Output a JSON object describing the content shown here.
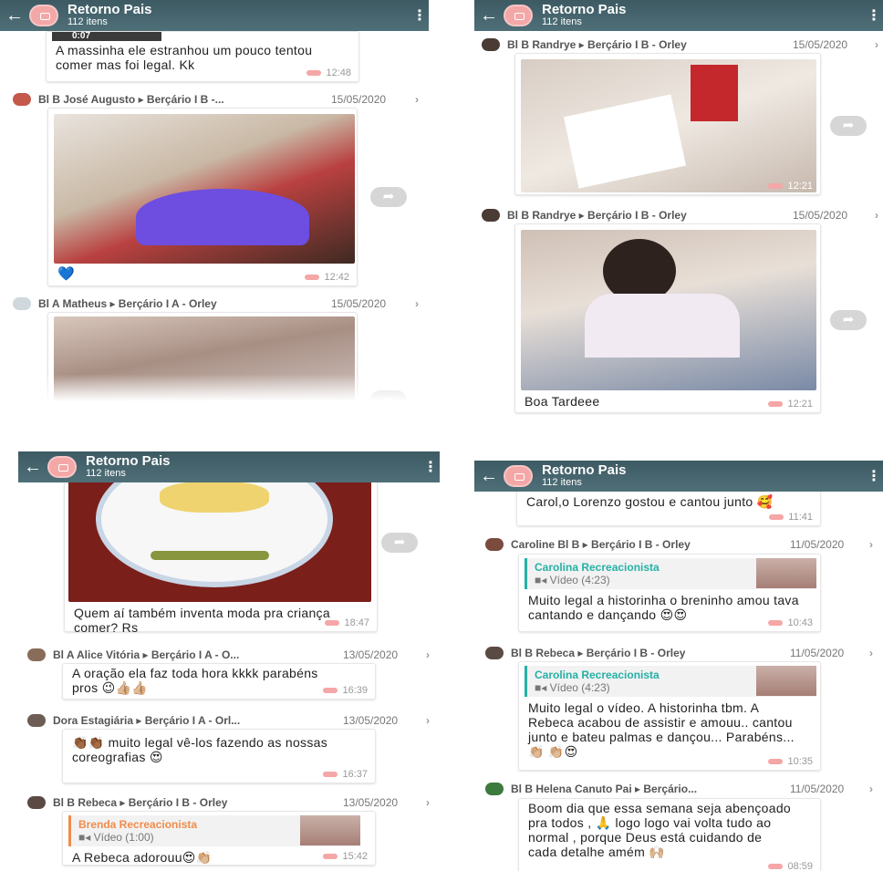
{
  "header": {
    "title": "Retorno Pais",
    "subtitle": "112 itens",
    "back_glyph": "←",
    "menu_glyph": "⋮"
  },
  "colors": {
    "appbar": "#4a6871",
    "avatar_pink": "#f4a7a7",
    "quote_teal": "#25b1a6",
    "quote_orange": "#f08c4a",
    "time_tag": "#f5a6a6"
  },
  "panel1": {
    "video_time": "0:07",
    "msg0": {
      "text": "A massinha ele estranhou um pouco tentou comer mas foi legal. Kk",
      "time": "12:48"
    },
    "msg1": {
      "sender": "Bl B José Augusto ▸ Berçário I B -...",
      "date": "15/05/2020",
      "emoji": "💙",
      "time": "12:42"
    },
    "msg2": {
      "sender": "Bl A Matheus ▸ Berçário I A - Orley",
      "date": "15/05/2020"
    }
  },
  "panel2": {
    "msg1": {
      "sender": "Bl B Randrye ▸ Berçário I B - Orley",
      "date": "15/05/2020",
      "time": "12:21"
    },
    "msg2": {
      "sender": "Bl B Randrye ▸ Berçário I B - Orley",
      "date": "15/05/2020",
      "text": "Boa Tardeee",
      "time": "12:21"
    }
  },
  "panel3": {
    "msg0": {
      "text": "Quem aí também inventa moda pra criança comer? Rs",
      "time": "18:47"
    },
    "msg1": {
      "sender": "Bl A Alice Vitória ▸ Berçário I A - O...",
      "date": "13/05/2020",
      "text": "A oração ela faz toda hora kkkk parabéns pros 😉👍🏼👍🏼",
      "time": "16:39"
    },
    "msg2": {
      "sender": "Dora Estagiária ▸ Berçário I A - Orl...",
      "date": "13/05/2020",
      "text": "👏🏾👏🏾 muito legal vê-los fazendo as nossas coreografias 😍",
      "time": "16:37"
    },
    "msg3": {
      "sender": "Bl B Rebeca ▸ Berçário I B - Orley",
      "date": "13/05/2020",
      "quote_name": "Brenda Recreacionista",
      "quote_meta": "■◂ Vídeo (1:00)",
      "text": "A Rebeca adorouu😍👏🏼",
      "time": "15:42"
    }
  },
  "panel4": {
    "msg0": {
      "text": "Carol,o Lorenzo gostou e cantou junto 🥰",
      "time": "11:41"
    },
    "msg1": {
      "sender": "Caroline Bl B ▸ Berçário I B - Orley",
      "date": "11/05/2020",
      "quote_name": "Carolina Recreacionista",
      "quote_meta": "■◂ Vídeo (4:23)",
      "text": "Muito legal a historinha o breninho amou tava cantando e dançando 😍😍",
      "time": "10:43"
    },
    "msg2": {
      "sender": "Bl B Rebeca ▸ Berçário I B - Orley",
      "date": "11/05/2020",
      "quote_name": "Carolina Recreacionista",
      "quote_meta": "■◂ Vídeo (4:23)",
      "text": "Muito legal o vídeo. A historinha tbm. A Rebeca acabou de assistir e amouu.. cantou junto e bateu palmas e dançou... Parabéns... 👏🏼 👏🏼😍",
      "time": "10:35"
    },
    "msg3": {
      "sender": "Bl B Helena Canuto Pai ▸ Berçário...",
      "date": "11/05/2020",
      "text": "Boom dia que essa semana seja abençoado pra todos , 🙏 logo logo vai volta tudo ao normal , porque Deus está cuidando de cada detalhe amém 🙌🏼",
      "time": "08:59"
    }
  }
}
